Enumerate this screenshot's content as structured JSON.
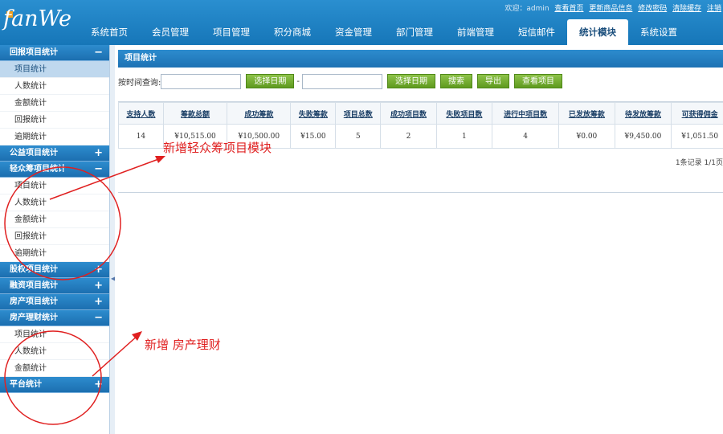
{
  "header": {
    "logo": "fanWe",
    "links_prefix": "欢迎：admin",
    "links": [
      "查看首页",
      "更新商品信息",
      "修改密码",
      "清除缓存",
      "注销"
    ]
  },
  "nav": {
    "items": [
      "系统首页",
      "会员管理",
      "项目管理",
      "积分商城",
      "资金管理",
      "部门管理",
      "前端管理",
      "短信邮件",
      "统计模块",
      "系统设置"
    ],
    "active": "统计模块"
  },
  "sidebar": {
    "sections": [
      {
        "title": "回报项目统计",
        "toggle": "−",
        "items": [
          "项目统计",
          "人数统计",
          "金额统计",
          "回报统计",
          "逾期统计"
        ]
      },
      {
        "title": "公益项目统计",
        "toggle": "+",
        "items": []
      },
      {
        "title": "轻众筹项目统计",
        "toggle": "−",
        "items": [
          "项目统计",
          "人数统计",
          "金额统计",
          "回报统计",
          "逾期统计"
        ]
      },
      {
        "title": "股权项目统计",
        "toggle": "+",
        "items": []
      },
      {
        "title": "融资项目统计",
        "toggle": "+",
        "items": []
      },
      {
        "title": "房产项目统计",
        "toggle": "+",
        "items": []
      },
      {
        "title": "房产理财统计",
        "toggle": "−",
        "items": [
          "项目统计",
          "人数统计",
          "金额统计"
        ]
      },
      {
        "title": "平台统计",
        "toggle": "+",
        "items": []
      }
    ]
  },
  "content": {
    "title": "项目统计",
    "filter": {
      "label": "按时间查询:",
      "start_value": "",
      "end_value": "",
      "date_btn_1": "选择日期",
      "date_btn_2": "选择日期",
      "separator": "-",
      "search_btn": "搜索",
      "export_btn": "导出",
      "view_btn": "查看项目"
    },
    "table": {
      "headers": [
        "支持人数",
        "筹款总额",
        "成功筹款",
        "失败筹款",
        "项目总数",
        "成功项目数",
        "失败项目数",
        "进行中项目数",
        "已发放筹款",
        "待发放筹款",
        "可获得佣金"
      ],
      "rows": [
        [
          "14",
          "¥10,515.00",
          "¥10,500.00",
          "¥15.00",
          "5",
          "2",
          "1",
          "4",
          "¥0.00",
          "¥9,450.00",
          "¥1,051.50"
        ]
      ]
    },
    "pager": "1条记录 1/1页"
  },
  "annotations": {
    "note_1": "新增轻众筹项目模块",
    "note_2": "新增 房产理财",
    "color": "#e02020"
  }
}
